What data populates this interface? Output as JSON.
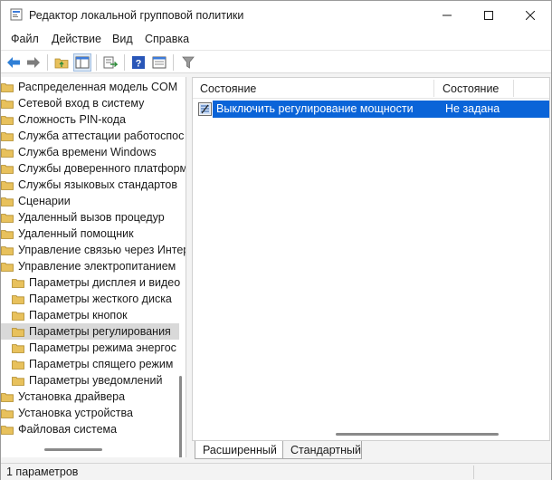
{
  "window": {
    "title": "Редактор локальной групповой политики"
  },
  "menu": {
    "items": [
      "Файл",
      "Действие",
      "Вид",
      "Справка"
    ]
  },
  "tree": {
    "items": [
      {
        "label": "Распределенная модель COM",
        "level": 0
      },
      {
        "label": "Сетевой вход в систему",
        "level": 0
      },
      {
        "label": "Сложность PIN-кода",
        "level": 0
      },
      {
        "label": "Служба аттестации работоспос",
        "level": 0
      },
      {
        "label": "Служба времени Windows",
        "level": 0
      },
      {
        "label": "Службы доверенного платформ",
        "level": 0
      },
      {
        "label": "Службы языковых стандартов",
        "level": 0
      },
      {
        "label": "Сценарии",
        "level": 0
      },
      {
        "label": "Удаленный вызов процедур",
        "level": 0
      },
      {
        "label": "Удаленный помощник",
        "level": 0
      },
      {
        "label": "Управление связью через Интер",
        "level": 0
      },
      {
        "label": "Управление электропитанием",
        "level": 0
      },
      {
        "label": "Параметры дисплея и видео",
        "level": 1
      },
      {
        "label": "Параметры жесткого диска",
        "level": 1
      },
      {
        "label": "Параметры кнопок",
        "level": 1
      },
      {
        "label": "Параметры регулирования",
        "level": 1,
        "selected": true
      },
      {
        "label": "Параметры режима энергос",
        "level": 1
      },
      {
        "label": "Параметры спящего режим",
        "level": 1
      },
      {
        "label": "Параметры уведомлений",
        "level": 1
      },
      {
        "label": "Установка драйвера",
        "level": 0
      },
      {
        "label": "Установка устройства",
        "level": 0
      },
      {
        "label": "Файловая система",
        "level": 0
      }
    ]
  },
  "list": {
    "columns": [
      "Состояние",
      "Состояние"
    ],
    "rows": [
      {
        "name": "Выключить регулирование мощности",
        "state": "Не задана"
      }
    ]
  },
  "tabs": [
    "Расширенный",
    "Стандартный"
  ],
  "status": {
    "text": "1 параметров"
  },
  "colors": {
    "selection": "#0a64d8",
    "folder": "#e8c15c",
    "tree_selected": "#d9d9d9"
  }
}
